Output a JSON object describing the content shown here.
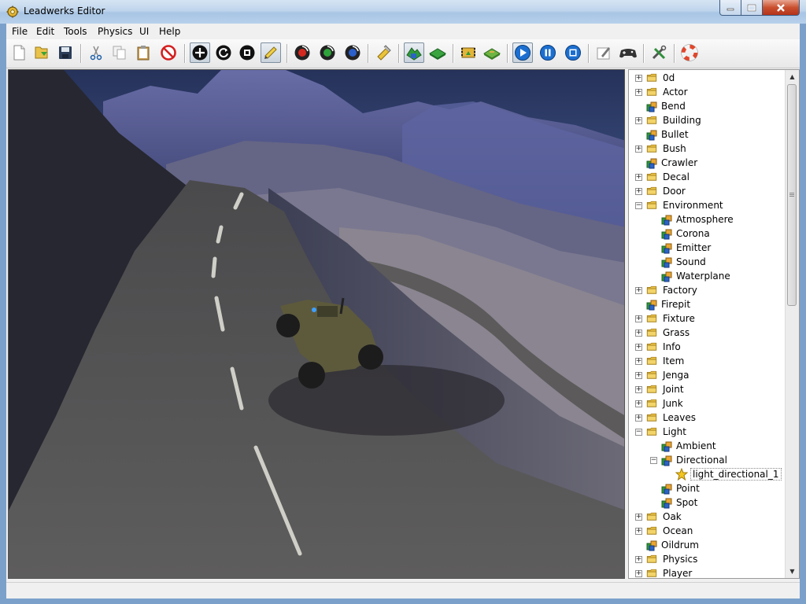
{
  "window": {
    "title": "Leadwerks Editor"
  },
  "menu": [
    "File",
    "Edit",
    "Tools",
    "Physics",
    "UI",
    "Help"
  ],
  "toolbar": {
    "icons": [
      "new-file-icon",
      "open-file-icon",
      "save-icon",
      "cut-icon",
      "copy-icon",
      "paste-icon",
      "delete-icon",
      "move-icon",
      "rotate-icon",
      "scale-icon",
      "select-icon",
      "record-red-icon",
      "record-green-icon",
      "record-blue-icon",
      "lock-icon",
      "terrain-icon",
      "terrain-flat-icon",
      "road-icon",
      "terrain-paint-icon",
      "play-icon",
      "pause-icon",
      "stop-icon",
      "script-editor-icon",
      "gamepad-icon",
      "tools-icon",
      "help-lifebuoy-icon"
    ]
  },
  "tree": [
    {
      "label": "0d",
      "type": "folder"
    },
    {
      "label": "Actor",
      "type": "folder"
    },
    {
      "label": "Bend",
      "type": "entity"
    },
    {
      "label": "Building",
      "type": "folder"
    },
    {
      "label": "Bullet",
      "type": "entity"
    },
    {
      "label": "Bush",
      "type": "folder"
    },
    {
      "label": "Crawler",
      "type": "entity"
    },
    {
      "label": "Decal",
      "type": "folder"
    },
    {
      "label": "Door",
      "type": "folder"
    },
    {
      "label": "Environment",
      "type": "folder",
      "expanded": true
    },
    {
      "label": "Atmosphere",
      "type": "entity",
      "depth": 1
    },
    {
      "label": "Corona",
      "type": "entity",
      "depth": 1
    },
    {
      "label": "Emitter",
      "type": "entity",
      "depth": 1
    },
    {
      "label": "Sound",
      "type": "entity",
      "depth": 1
    },
    {
      "label": "Waterplane",
      "type": "entity",
      "depth": 1
    },
    {
      "label": "Factory",
      "type": "folder"
    },
    {
      "label": "Firepit",
      "type": "entity"
    },
    {
      "label": "Fixture",
      "type": "folder"
    },
    {
      "label": "Grass",
      "type": "folder"
    },
    {
      "label": "Info",
      "type": "folder"
    },
    {
      "label": "Item",
      "type": "folder"
    },
    {
      "label": "Jenga",
      "type": "folder"
    },
    {
      "label": "Joint",
      "type": "folder"
    },
    {
      "label": "Junk",
      "type": "folder"
    },
    {
      "label": "Leaves",
      "type": "folder"
    },
    {
      "label": "Light",
      "type": "folder",
      "expanded": true
    },
    {
      "label": "Ambient",
      "type": "entity",
      "depth": 1
    },
    {
      "label": "Directional",
      "type": "entity",
      "depth": 1,
      "expanded": true
    },
    {
      "label": "light_directional_1",
      "type": "instance",
      "depth": 2,
      "selected": true
    },
    {
      "label": "Point",
      "type": "entity",
      "depth": 1
    },
    {
      "label": "Spot",
      "type": "entity",
      "depth": 1
    },
    {
      "label": "Oak",
      "type": "folder"
    },
    {
      "label": "Ocean",
      "type": "folder"
    },
    {
      "label": "Oildrum",
      "type": "entity"
    },
    {
      "label": "Physics",
      "type": "folder"
    },
    {
      "label": "Player",
      "type": "folder"
    }
  ]
}
